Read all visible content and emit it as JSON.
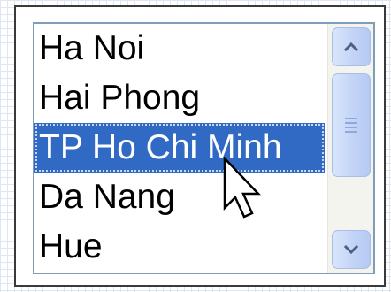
{
  "listbox": {
    "items": [
      {
        "label": "Ha Noi",
        "selected": false
      },
      {
        "label": "Hai Phong",
        "selected": false
      },
      {
        "label": "TP Ho Chi Minh",
        "selected": true
      },
      {
        "label": "Da Nang",
        "selected": false
      },
      {
        "label": "Hue",
        "selected": false
      }
    ]
  },
  "scrollbar": {
    "up_icon": "chevron-up-icon",
    "down_icon": "chevron-down-icon",
    "thumb_grip_icon": "grip-icon"
  },
  "cursor": {
    "icon": "mouse-pointer-icon"
  },
  "colors": {
    "selection": "#316ac5",
    "selection_text": "#ffffff",
    "listbox_border": "#7f9db9",
    "panel_border": "#3a3a3a",
    "scroll_button": "#c3d4f7"
  }
}
